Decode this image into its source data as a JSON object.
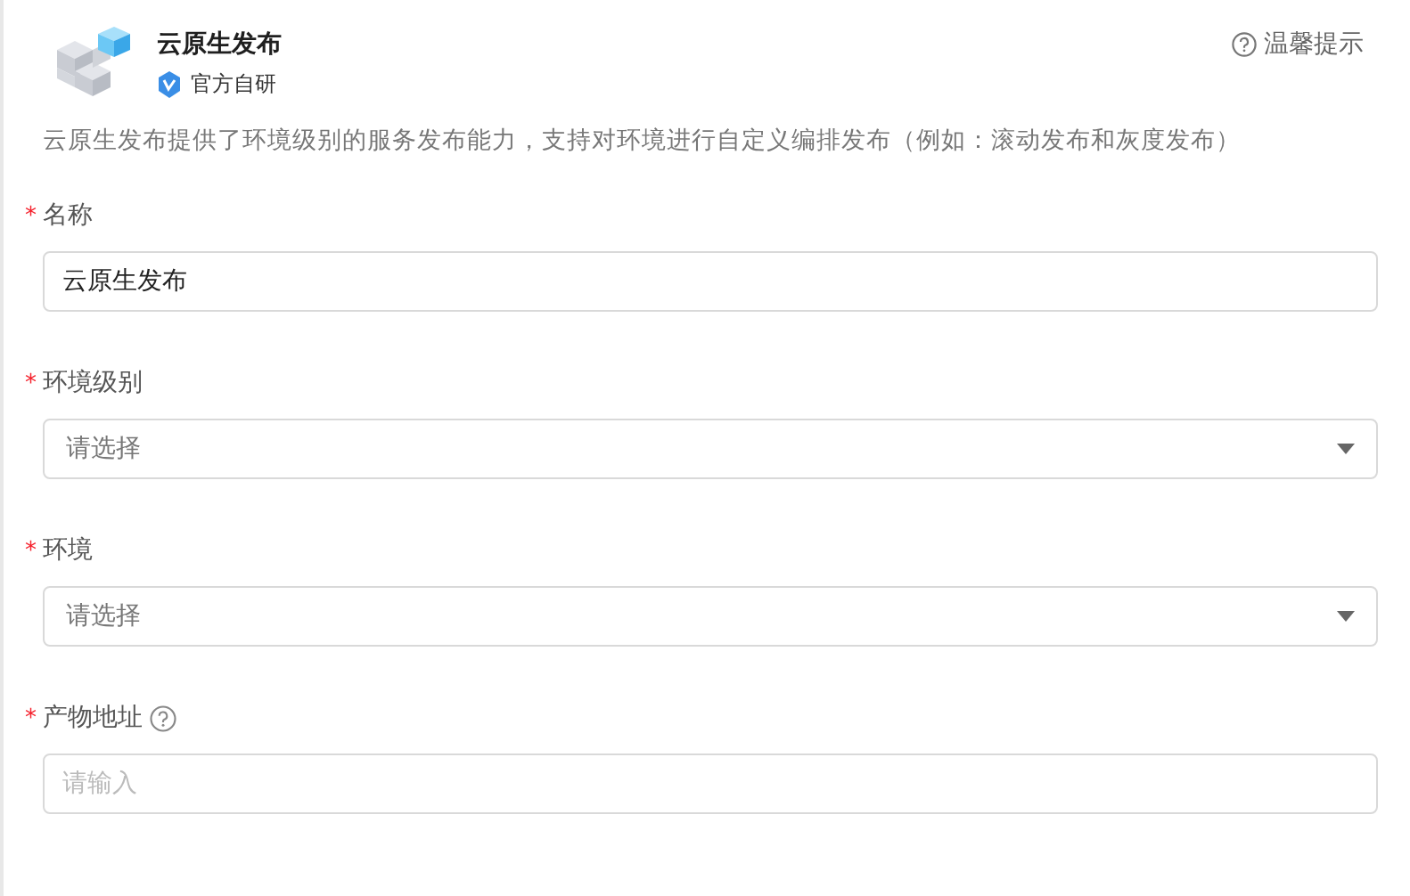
{
  "header": {
    "title": "云原生发布",
    "badge": "官方自研",
    "tip": "温馨提示"
  },
  "description": "云原生发布提供了环境级别的服务发布能力，支持对环境进行自定义编排发布（例如：滚动发布和灰度发布）",
  "fields": [
    {
      "label": "名称",
      "required_mark": "*",
      "kind": "input",
      "value": "云原生发布"
    },
    {
      "label": "环境级别",
      "required_mark": "*",
      "kind": "select",
      "placeholder": "请选择"
    },
    {
      "label": "环境",
      "required_mark": "*",
      "kind": "select",
      "placeholder": "请选择"
    },
    {
      "label": "产物地址",
      "required_mark": "*",
      "kind": "input",
      "placeholder": "请输入",
      "help": true
    }
  ]
}
